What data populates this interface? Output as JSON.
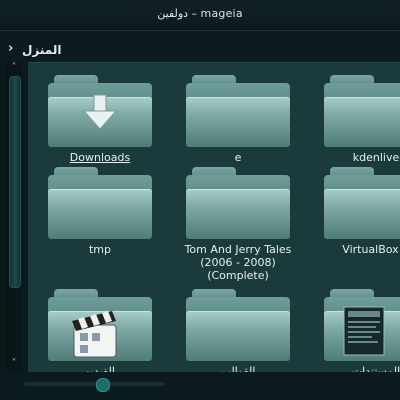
{
  "window": {
    "title": "دولفين – mageia"
  },
  "breadcrumb": {
    "chevron": "›",
    "location": "المنزل"
  },
  "scroll": {
    "up": "˄",
    "down": "˅"
  },
  "items": [
    {
      "label": "Downloads",
      "icon": "download-arrow-icon"
    },
    {
      "label": "e",
      "icon": "folder-icon"
    },
    {
      "label": "kdenlive",
      "icon": "folder-icon"
    },
    {
      "label": "tmp",
      "icon": "folder-icon"
    },
    {
      "label": "Tom And Jerry Tales (2006 - 2008) (Complete)",
      "icon": "folder-icon"
    },
    {
      "label": "VirtualBox V",
      "icon": "folder-icon"
    },
    {
      "label": "الفيديو",
      "icon": "video-clapper-icon"
    },
    {
      "label": "القوالب",
      "icon": "folder-icon"
    },
    {
      "label": "المستندات",
      "icon": "document-icon"
    }
  ],
  "zoom": {
    "level": 0.4
  }
}
